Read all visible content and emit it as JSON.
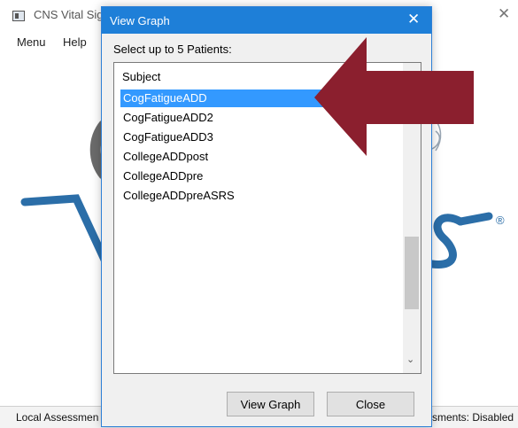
{
  "main_window": {
    "title": "CNS Vital Sig",
    "menu": [
      "Menu",
      "Help"
    ],
    "registered_mark": "®",
    "status_left": "Local Assessmen",
    "status_right": "sments: Disabled"
  },
  "dialog": {
    "title": "View Graph",
    "close_glyph": "✕",
    "instruction": "Select up to 5 Patients:",
    "list_header": "Subject",
    "patients": [
      "CogFatigueADD",
      "CogFatigueADD2",
      "CogFatigueADD3",
      "CollegeADDpost",
      "CollegeADDpre",
      "CollegeADDpreASRS"
    ],
    "selected_index": 0,
    "scroll_down_glyph": "⌄",
    "buttons": {
      "view_graph": "View Graph",
      "close": "Close"
    }
  },
  "colors": {
    "dialog_titlebar": "#1e7fd8",
    "selection": "#3399ff",
    "overlay_arrow": "#8b1f2e",
    "logo_blue": "#2b6ea8",
    "logo_gray": "#6b6b6b"
  },
  "icons": {
    "main_app": "app-window-icon",
    "main_close": "close-icon",
    "dialog_close": "close-icon",
    "scroll_down": "chevron-down-icon",
    "overlay": "arrow-left-icon"
  }
}
